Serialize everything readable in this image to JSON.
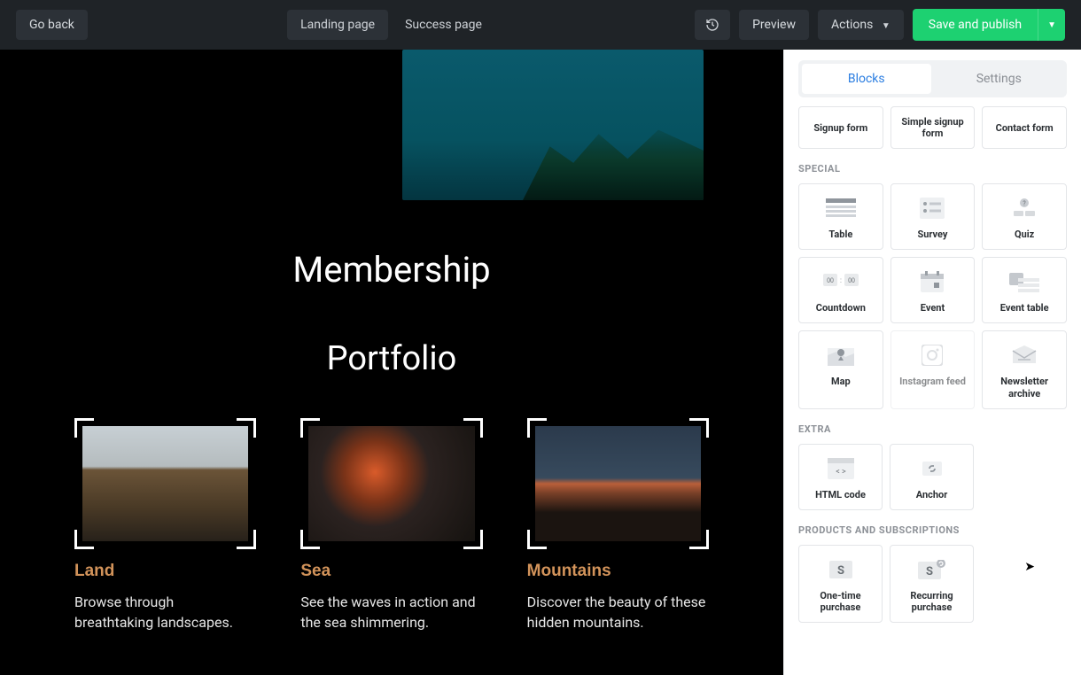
{
  "header": {
    "go_back": "Go back",
    "tabs": [
      "Landing page",
      "Success page"
    ],
    "preview": "Preview",
    "actions": "Actions",
    "publish": "Save and publish"
  },
  "canvas": {
    "heading1": "Membership",
    "heading2": "Portfolio",
    "cards": [
      {
        "title": "Land",
        "desc": "Browse through breathtaking landscapes."
      },
      {
        "title": "Sea",
        "desc": "See the waves in action and the sea shimmering."
      },
      {
        "title": "Mountains",
        "desc": "Discover the beauty of these hidden mountains."
      }
    ]
  },
  "sidebar": {
    "tabs": [
      "Blocks",
      "Settings"
    ],
    "forms": [
      "Signup form",
      "Simple signup form",
      "Contact form"
    ],
    "sections": [
      {
        "label": "SPECIAL",
        "items": [
          "Table",
          "Survey",
          "Quiz",
          "Countdown",
          "Event",
          "Event table",
          "Map",
          "Instagram feed",
          "Newsletter archive"
        ]
      },
      {
        "label": "EXTRA",
        "items": [
          "HTML code",
          "Anchor"
        ]
      },
      {
        "label": "PRODUCTS AND SUBSCRIPTIONS",
        "items": [
          "One-time purchase",
          "Recurring purchase"
        ]
      }
    ]
  }
}
